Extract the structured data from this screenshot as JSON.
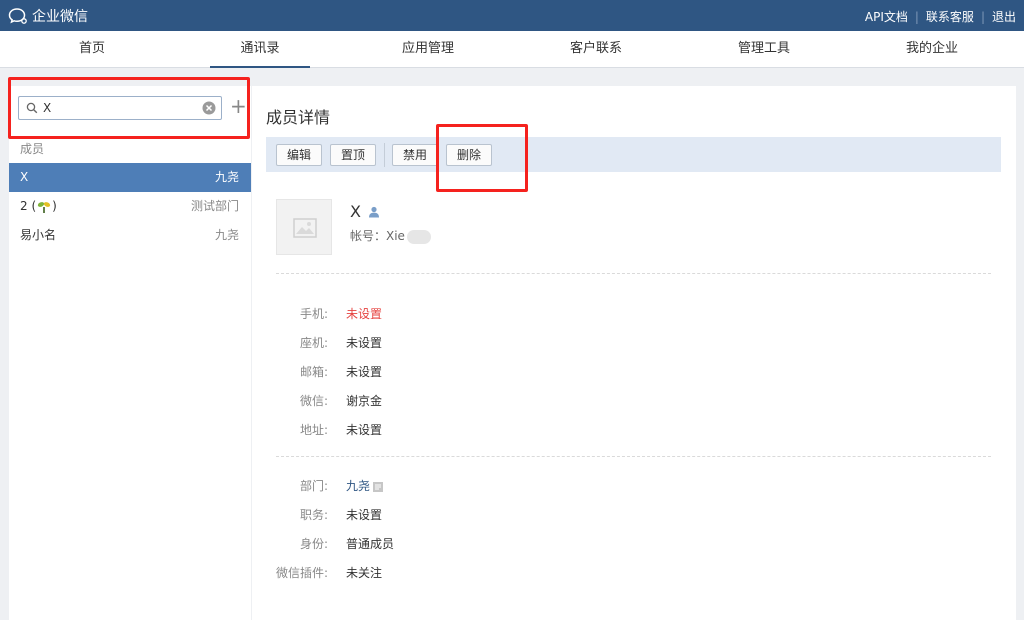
{
  "topbar": {
    "brand": "企业微信",
    "links": [
      "API文档",
      "联系客服",
      "退出"
    ]
  },
  "nav": {
    "tabs": [
      {
        "label": "首页"
      },
      {
        "label": "通讯录"
      },
      {
        "label": "应用管理"
      },
      {
        "label": "客户联系"
      },
      {
        "label": "管理工具"
      },
      {
        "label": "我的企业"
      }
    ],
    "active": "通讯录"
  },
  "left": {
    "search": {
      "value": "X"
    },
    "section_label": "成员",
    "members": [
      {
        "name": "X",
        "dept": "九尧",
        "selected": true
      },
      {
        "name_prefix": "2 (",
        "name_suffix": ")",
        "dept": "测试部门",
        "selected": false
      },
      {
        "name": "易小名",
        "dept": "九尧",
        "selected": false
      }
    ]
  },
  "detail": {
    "title": "成员详情",
    "toolbar": {
      "edit": "编辑",
      "pin": "置顶",
      "disable": "禁用",
      "delete": "删除"
    },
    "name": "X",
    "account_label": "帐号：Xie",
    "contact": [
      {
        "label": "手机:",
        "value": "未设置"
      },
      {
        "label": "座机:",
        "value": "未设置"
      },
      {
        "label": "邮箱:",
        "value": "未设置"
      },
      {
        "label": "微信:",
        "value": "谢京金"
      },
      {
        "label": "地址:",
        "value": "未设置"
      }
    ],
    "org": [
      {
        "label": "部门:",
        "value": "九尧"
      },
      {
        "label": "职务:",
        "value": "未设置"
      },
      {
        "label": "身份:",
        "value": "普通成员"
      },
      {
        "label": "微信插件:",
        "value": "未关注"
      }
    ]
  },
  "colors": {
    "topbar": "#2f5683",
    "selected_row": "#4e7eb7",
    "highlight": "#f5221e",
    "unset_red": "#e64340"
  }
}
